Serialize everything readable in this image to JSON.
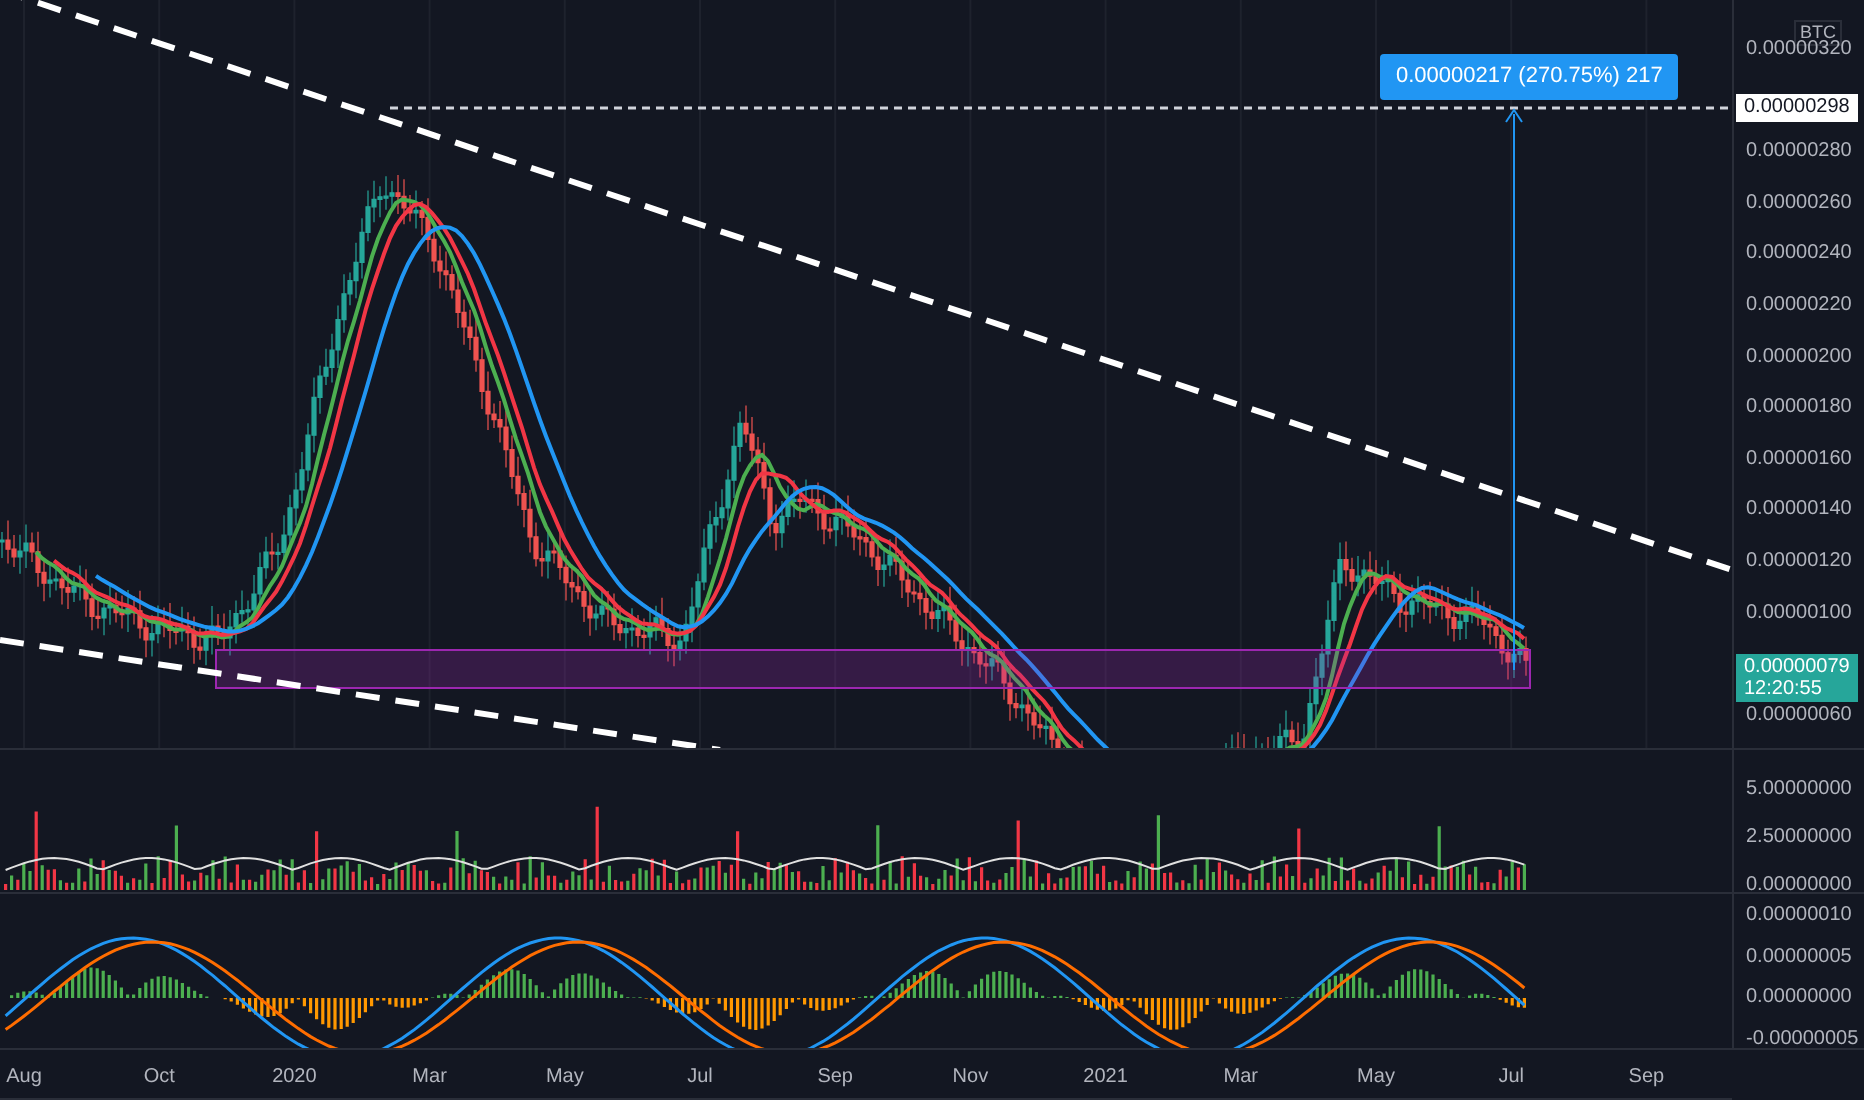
{
  "price_axis": {
    "currency": "BTC",
    "ticks": [
      "0.00000320",
      "0.00000280",
      "0.00000260",
      "0.00000240",
      "0.00000220",
      "0.00000200",
      "0.00000180",
      "0.00000160",
      "0.00000140",
      "0.00000120",
      "0.00000100",
      "0.00000060"
    ],
    "target_price": "0.00000298",
    "last_price": "0.00000079",
    "countdown": "12:20:55"
  },
  "measure_label": "0.00000217 (270.75%) 217",
  "volume_axis": {
    "ticks": [
      "5.00000000",
      "2.50000000",
      "0.00000000"
    ]
  },
  "macd_axis": {
    "ticks": [
      "0.00000010",
      "0.00000005",
      "0.00000000",
      "-0.00000005"
    ]
  },
  "time_axis": {
    "labels": [
      "Aug",
      "Oct",
      "2020",
      "Mar",
      "May",
      "Jul",
      "Sep",
      "Nov",
      "2021",
      "Mar",
      "May",
      "Jul",
      "Sep"
    ]
  }
}
